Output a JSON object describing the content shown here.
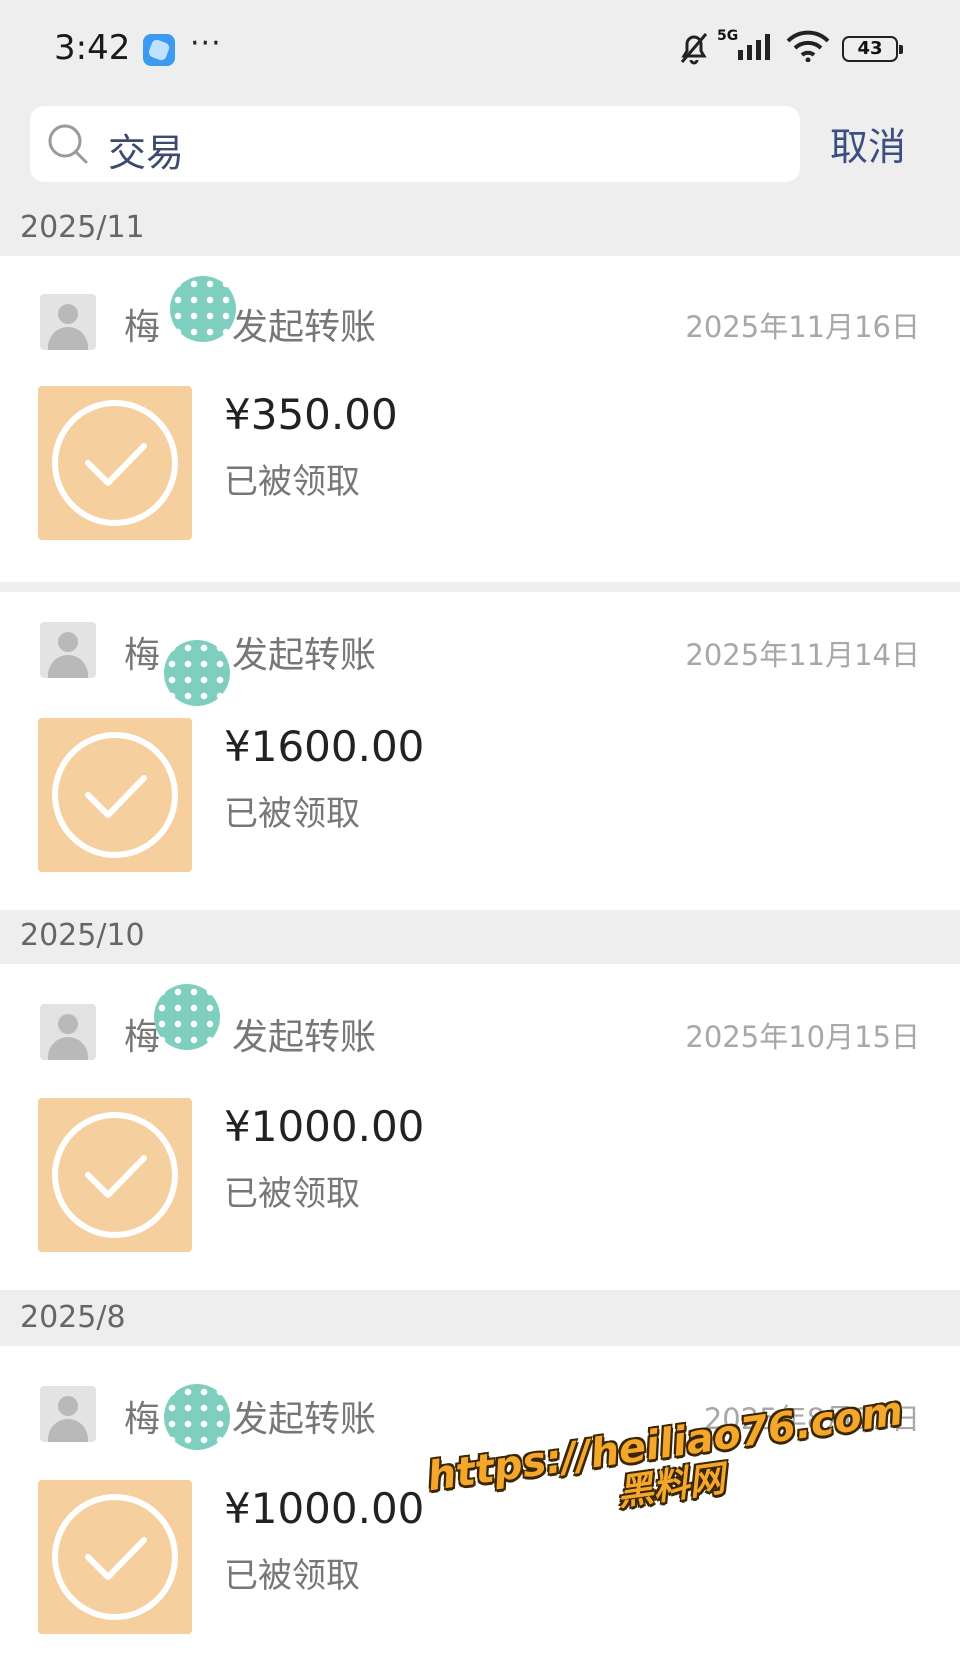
{
  "status_bar": {
    "time": "3:42",
    "dots": "···",
    "network": "5G",
    "battery": "43"
  },
  "search": {
    "query": "交易",
    "cancel_label": "取消"
  },
  "months": [
    {
      "label": "2025/11"
    },
    {
      "label": "2025/10"
    },
    {
      "label": "2025/8"
    }
  ],
  "transactions": [
    {
      "name_first": "梅",
      "title_suffix": "发起转账",
      "date": "2025年11月16日",
      "amount": "¥350.00",
      "status": "已被领取"
    },
    {
      "name_first": "梅",
      "title_suffix": "发起转账",
      "date": "2025年11月14日",
      "amount": "¥1600.00",
      "status": "已被领取"
    },
    {
      "name_first": "梅",
      "title_suffix": "发起转账",
      "date": "2025年10月15日",
      "amount": "¥1000.00",
      "status": "已被领取"
    },
    {
      "name_first": "梅",
      "title_suffix": "发起转账",
      "date": "2025年8月22日",
      "amount": "¥1000.00",
      "status": "已被领取"
    }
  ],
  "watermark": {
    "url": "https://heiliao76.com",
    "name": "黑料网"
  },
  "colors": {
    "transfer_icon_bg": "#f6cf9e",
    "cancel_text": "#3d4f80",
    "page_bg": "#eeeeee"
  }
}
